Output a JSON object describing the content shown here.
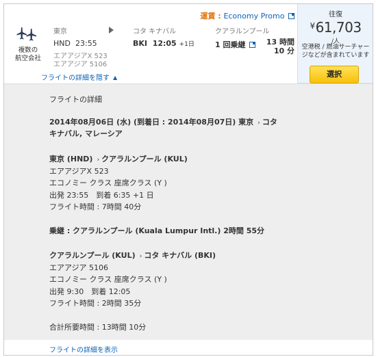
{
  "fare": {
    "label": "運賃 : ",
    "class_name": "Economy Promo"
  },
  "airline": {
    "label_1": "複数の",
    "label_2": "航空会社"
  },
  "departure": {
    "city": "東京",
    "code": "HND",
    "time": "23:55",
    "carrier_1": "エアアジアX 523",
    "carrier_2": "エアアジア 5106"
  },
  "arrival": {
    "city": "コタ キナバル",
    "code": "BKI",
    "time": "12:05",
    "day_offset": "+1日"
  },
  "layover": {
    "city": "クアラルンプール",
    "stops": "1 回乗継"
  },
  "duration": {
    "line1": "13 時間",
    "line2": "10 分"
  },
  "toggle_hide": "フライトの詳細を隠す",
  "price": {
    "trip_type": "往復",
    "currency_symbol": "¥",
    "amount": "61,703",
    "per_person": "/人",
    "tax_line1": "空港税 / 燃油サーチャー",
    "tax_line2": "ジなどが含まれています",
    "select_label": "選択"
  },
  "details": {
    "title": "フライトの詳細",
    "date_line1": "2014年08月06日 (水) (到着日 : 2014年08月07日) 東京",
    "date_line1_dest": "コタ",
    "date_line2": "キナバル, マレーシア",
    "seg1": {
      "route_from": "東京 (HND)",
      "route_to": "クアラルンプール (KUL)",
      "flight": "エアアジアX 523",
      "cabin": "エコノミー クラス 座席クラス (Y )",
      "times": "出発 23:55　到着 6:35 +1 日",
      "duration": "フライト時間 : 7時間 40分"
    },
    "layover": "乗継 : クアラルンプール (Kuala Lumpur Intl.) 2時間 55分",
    "seg2": {
      "route_from": "クアラルンプール (KUL)",
      "route_to": "コタ キナバル (BKI)",
      "flight": "エアアジア 5106",
      "cabin": "エコノミー クラス 座席クラス (Y )",
      "times": "出発 9:30　到着 12:05",
      "duration": "フライト時間 : 2時間 35分"
    },
    "total": "合計所要時間 : 13時間 10分"
  },
  "toggle_show": "フライトの詳細を表示",
  "colors": {
    "link": "#0d63b5",
    "fare_label": "#e3760c",
    "button": "#f7c10c",
    "panel": "#eeeeee",
    "price_bg": "#edf3fa"
  },
  "icons": {
    "airline": "airplanes-icon",
    "arrow": "right-arrow-icon",
    "external": "external-link-icon",
    "caret": "caret-up-icon"
  }
}
